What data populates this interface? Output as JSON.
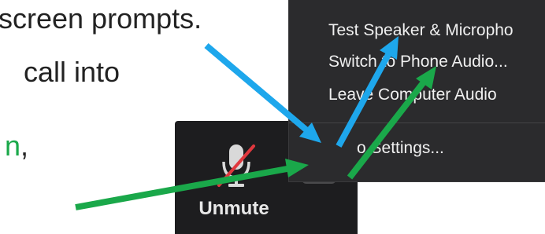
{
  "document": {
    "line1": "screen prompts.",
    "line2": "call into",
    "line3_green": "n",
    "line3_rest": ","
  },
  "toolbar": {
    "unmute_label": "Unmute",
    "mic_icon": "microphone-muted-icon",
    "caret_icon": "caret-up-icon"
  },
  "audio_menu": {
    "items": [
      {
        "label": "Test Speaker & Micropho"
      },
      {
        "label": "Switch to Phone Audio..."
      },
      {
        "label": "Leave Computer Audio"
      },
      {
        "label": "o Settings..."
      }
    ]
  },
  "annotations": {
    "arrow_colors": {
      "blue": "#1ea7ec",
      "green": "#1aa84a"
    }
  }
}
